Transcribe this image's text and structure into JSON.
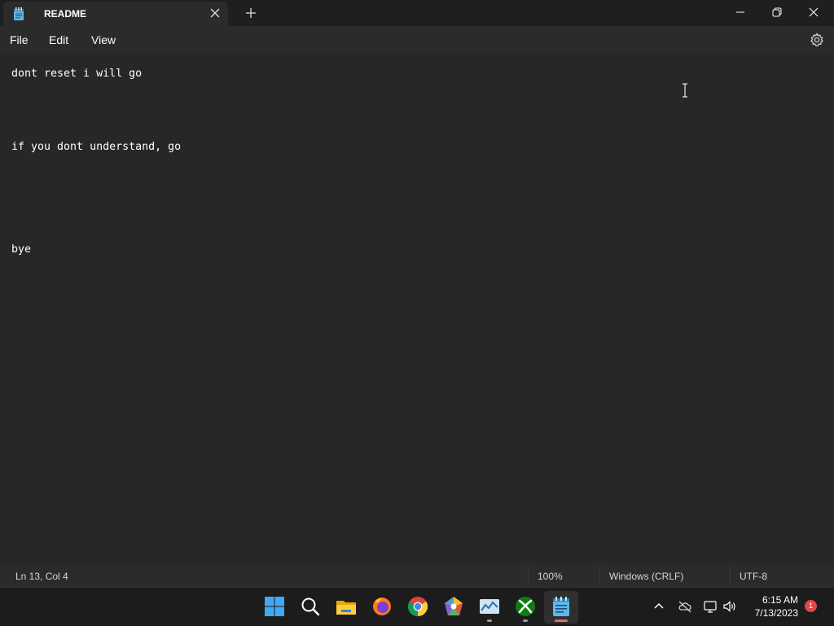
{
  "window": {
    "tab_title": "README"
  },
  "menu": {
    "file": "File",
    "edit": "Edit",
    "view": "View"
  },
  "document": {
    "lines": [
      "dont reset i will go",
      "if you dont understand, go",
      "bye"
    ]
  },
  "status": {
    "position": "Ln 13, Col 4",
    "zoom": "100%",
    "line_ending": "Windows (CRLF)",
    "encoding": "UTF-8"
  },
  "taskbar": {
    "apps": [
      "start-icon",
      "search-icon",
      "file-explorer-icon",
      "firefox-icon",
      "chrome-icon",
      "paint-icon",
      "task-manager-icon",
      "xbox-icon",
      "notepad-icon"
    ],
    "time": "6:15 AM",
    "date": "7/13/2023",
    "notifications": "1"
  },
  "colors": {
    "background": "#272727",
    "titlebar": "#1f1f1f",
    "accent_notepad": "#4cc2ff",
    "notification_badge": "#e04848"
  }
}
